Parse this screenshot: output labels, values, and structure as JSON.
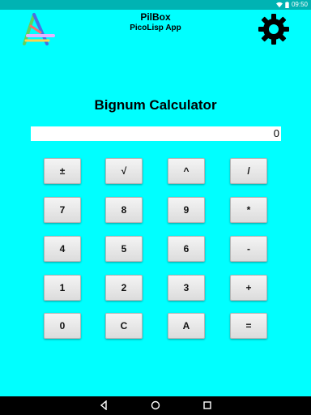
{
  "status_bar": {
    "time": "09:50",
    "icons": [
      "wifi-icon",
      "battery-icon"
    ],
    "color": "#00b3b3"
  },
  "header": {
    "app_name": "PilBox",
    "subtitle": "PicoLisp App",
    "logo_icon": "pilbox-logo-icon",
    "settings_icon": "gear-icon"
  },
  "calculator": {
    "title": "Bignum Calculator",
    "display_value": "0",
    "keys": [
      [
        "±",
        "√",
        "^",
        "/"
      ],
      [
        "7",
        "8",
        "9",
        "*"
      ],
      [
        "4",
        "5",
        "6",
        "-"
      ],
      [
        "1",
        "2",
        "3",
        "+"
      ],
      [
        "0",
        "C",
        "A",
        "="
      ]
    ]
  },
  "nav_bar": {
    "buttons": [
      "back-icon",
      "home-icon",
      "recents-icon"
    ]
  },
  "colors": {
    "background": "#00ffff",
    "status_bar": "#00b3b3",
    "nav_bar": "#000000"
  }
}
